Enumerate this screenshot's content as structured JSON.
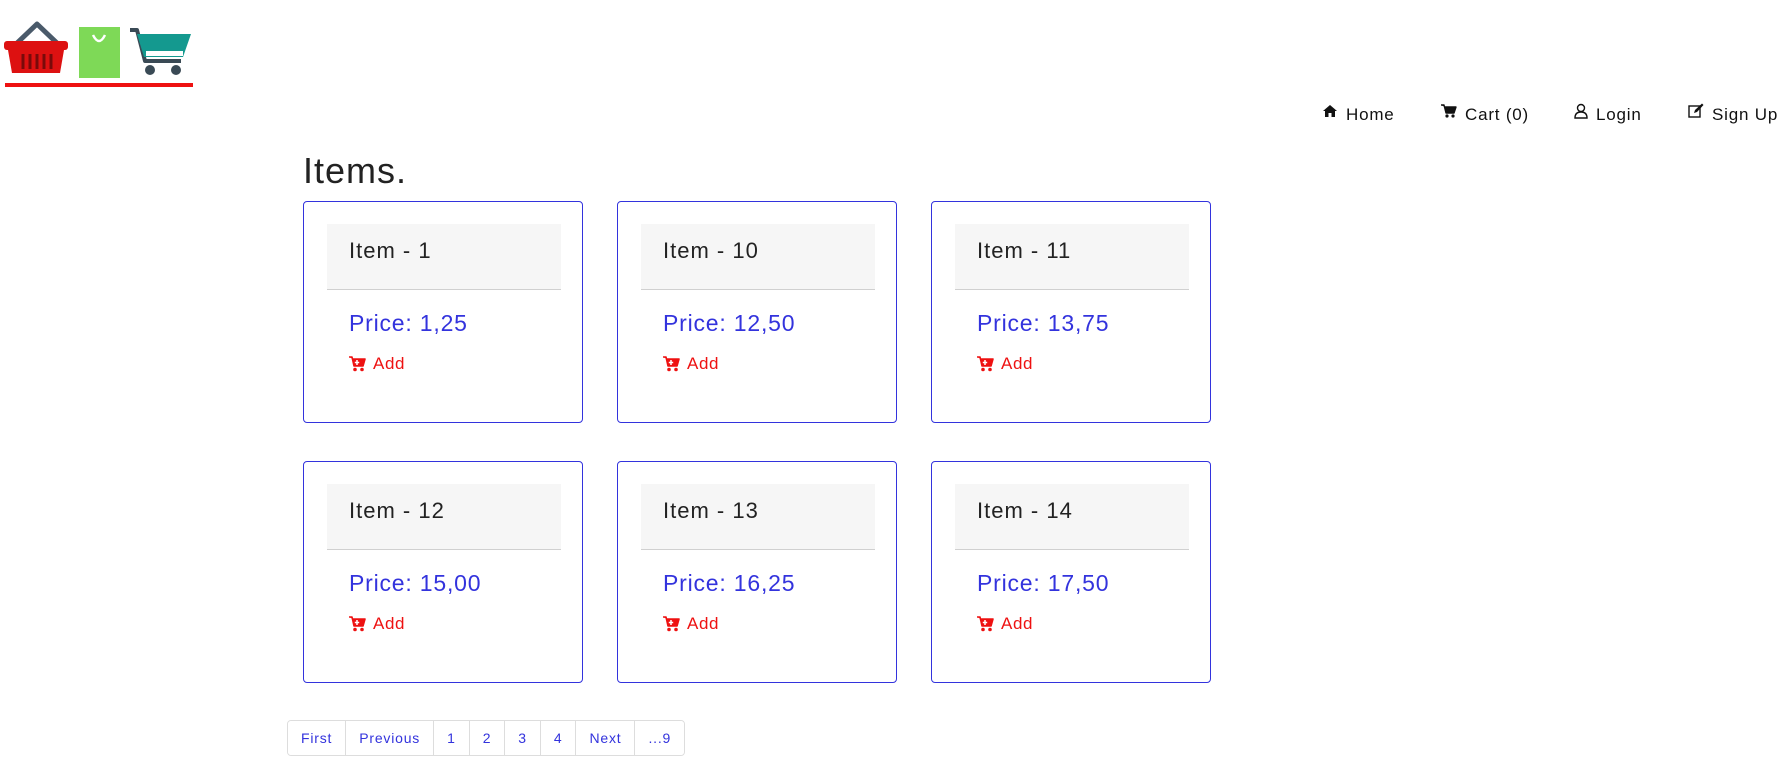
{
  "app": {
    "logo_alt": "shopping basket, bag and cart logo"
  },
  "nav": [
    {
      "label": "Home",
      "icon": "home-icon"
    },
    {
      "label": "Cart (0)",
      "icon": "cart-icon"
    },
    {
      "label": "Login",
      "icon": "user-icon"
    },
    {
      "label": "Sign Up",
      "icon": "edit-icon"
    }
  ],
  "page": {
    "title": "Items."
  },
  "items": [
    {
      "name": "Item - 1",
      "price": "Price: 1,25",
      "add_label": "Add"
    },
    {
      "name": "Item - 10",
      "price": "Price: 12,50",
      "add_label": "Add"
    },
    {
      "name": "Item - 11",
      "price": "Price: 13,75",
      "add_label": "Add"
    },
    {
      "name": "Item - 12",
      "price": "Price: 15,00",
      "add_label": "Add"
    },
    {
      "name": "Item - 13",
      "price": "Price: 16,25",
      "add_label": "Add"
    },
    {
      "name": "Item - 14",
      "price": "Price: 17,50",
      "add_label": "Add"
    }
  ],
  "pagination": [
    "First",
    "Previous",
    "1",
    "2",
    "3",
    "4",
    "Next",
    "...9"
  ],
  "colors": {
    "accent": "#3333dd",
    "add": "#ee1111",
    "logo_red": "#dd1111",
    "logo_green": "#7ed957",
    "logo_teal": "#14998f"
  }
}
